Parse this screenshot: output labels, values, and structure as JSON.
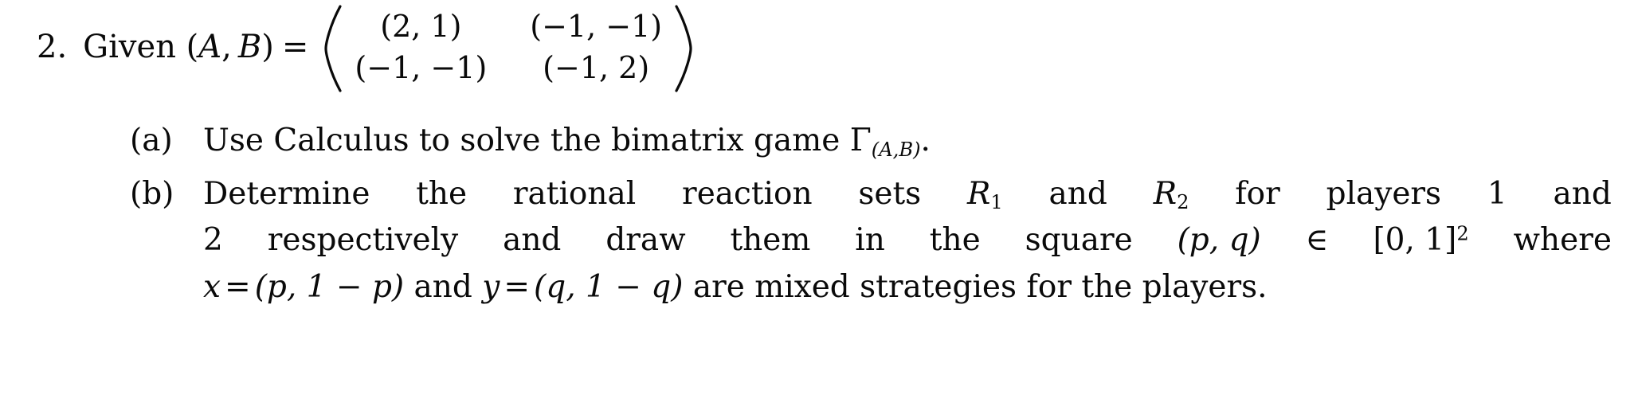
{
  "document": {
    "type": "math-exercise",
    "background_color": "#ffffff",
    "text_color": "#0a0a0a"
  },
  "problem": {
    "number": "2.",
    "lead_text": "Given",
    "lead_symbol_open": "(",
    "lead_symbol_a": "A",
    "lead_symbol_comma": ",",
    "lead_symbol_b": "B",
    "lead_symbol_close": ")",
    "equals": "=",
    "matrix": {
      "rows": 2,
      "cols": 2,
      "bracket": "parentheses",
      "cells": [
        [
          "(2, 1)",
          "(−1, −1)"
        ],
        [
          "(−1, −1)",
          "(−1, 2)"
        ]
      ]
    }
  },
  "subitems": [
    {
      "marker": "(a)",
      "lines": [
        {
          "justify": false,
          "text": "Use Calculus to solve the bimatrix game",
          "gamma": "Γ",
          "gamma_subscript": "(A,B)",
          "terminator": "."
        }
      ]
    },
    {
      "marker": "(b)",
      "lines": [
        {
          "justify": true,
          "words": [
            "Determine",
            "the",
            "rational",
            "reaction",
            "sets"
          ],
          "r1_symbol": "R",
          "r1_index": "1",
          "and_1": "and",
          "r2_symbol": "R",
          "r2_index": "2",
          "tail_words": [
            "for",
            "players",
            "1",
            "and"
          ]
        },
        {
          "justify": true,
          "lead": "2",
          "words": [
            "respectively",
            "and",
            "draw",
            "them",
            "in",
            "the",
            "square"
          ],
          "pq": "(p, q)",
          "member": "∈",
          "interval": "[0, 1]",
          "interval_exponent": "2",
          "tail": "where"
        },
        {
          "justify": false,
          "x_symbol": "x",
          "eq1": "=",
          "x_value": "(p, 1 − p)",
          "and": "and",
          "y_symbol": "y",
          "eq2": "=",
          "y_value": "(q, 1 − q)",
          "tail": "are mixed strategies for the players."
        }
      ]
    }
  ]
}
